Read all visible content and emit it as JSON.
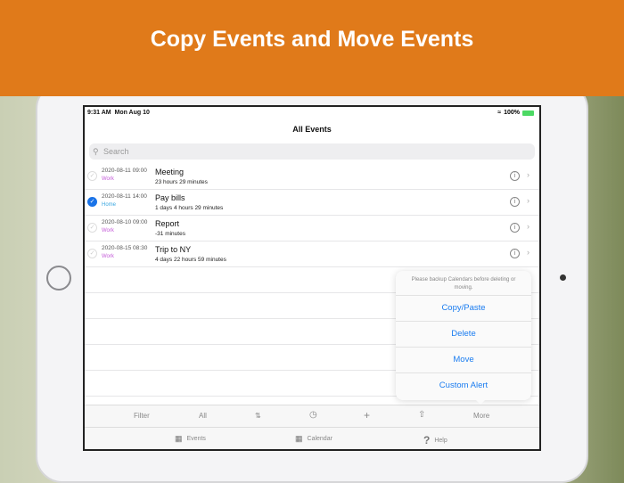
{
  "banner": "Copy Events and Move Events",
  "status": {
    "time": "9:31 AM",
    "date": "Mon Aug 10",
    "battery": "100%"
  },
  "title": "All Events",
  "search_placeholder": "Search",
  "events": [
    {
      "date": "2020-08-11 09:00",
      "calendar": "Work",
      "name": "Meeting",
      "duration": "23 hours  29 minutes",
      "checked": false,
      "color": "#c45bd8"
    },
    {
      "date": "2020-08-11 14:00",
      "calendar": "Home",
      "name": "Pay bills",
      "duration": "1 days  4 hours  29 minutes",
      "checked": true,
      "color": "#3aa7e0"
    },
    {
      "date": "2020-08-10 09:00",
      "calendar": "Work",
      "name": "Report",
      "duration": "-31 minutes",
      "checked": false,
      "color": "#c45bd8"
    },
    {
      "date": "2020-08-15 08:30",
      "calendar": "Work",
      "name": "Trip to NY",
      "duration": "4 days  22 hours  59 minutes",
      "checked": false,
      "color": "#c45bd8"
    }
  ],
  "popover": {
    "message": "Please backup Calendars before deleting or moving.",
    "items": [
      "Copy/Paste",
      "Delete",
      "Move",
      "Custom Alert"
    ]
  },
  "toolbar": {
    "filter": "Filter",
    "all": "All",
    "more": "More"
  },
  "tabs": {
    "events": "Events",
    "calendar": "Calendar",
    "help": "Help"
  }
}
